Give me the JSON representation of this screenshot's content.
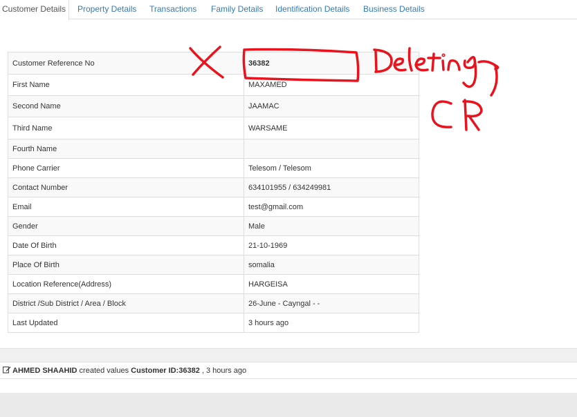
{
  "tabs": [
    {
      "label": "Customer Details",
      "active": true
    },
    {
      "label": "Property Details",
      "active": false
    },
    {
      "label": "Transactions",
      "active": false
    },
    {
      "label": "Family Details",
      "active": false
    },
    {
      "label": "Identification Details",
      "active": false
    },
    {
      "label": "Business Details",
      "active": false
    }
  ],
  "details": [
    {
      "label": "Customer Reference No",
      "value": "36382"
    },
    {
      "label": "First Name",
      "value": "MAXAMED"
    },
    {
      "label": "Second Name",
      "value": "JAAMAC"
    },
    {
      "label": "Third Name",
      "value": "WARSAME"
    },
    {
      "label": "Fourth Name",
      "value": ""
    },
    {
      "label": "Phone Carrier",
      "value": "Telesom / Telesom"
    },
    {
      "label": "Contact Number",
      "value": "634101955 / 634249981"
    },
    {
      "label": "Email",
      "value": "test@gmail.com"
    },
    {
      "label": "Gender",
      "value": "Male"
    },
    {
      "label": "Date Of Birth",
      "value": "21-10-1969"
    },
    {
      "label": "Place Of Birth",
      "value": "somalia"
    },
    {
      "label": "Location Reference(Address)",
      "value": "HARGEISA"
    },
    {
      "label": "District /Sub District / Area / Block",
      "value": "26-June - Cayngal - -"
    },
    {
      "label": "Last Updated",
      "value": "3 hours ago"
    }
  ],
  "activity": {
    "user": "AHMED SHAAHID",
    "action": " created values ",
    "entity": "Customer ID:36382",
    "time": " , 3 hours ago",
    "icon": "edit-icon"
  },
  "annotation": {
    "mark": "X",
    "line1": "Deleting",
    "line2": "CR",
    "color": "#e8131d"
  },
  "colors": {
    "link": "#337ab7",
    "border": "#dddddd",
    "annotation": "#e8131d"
  }
}
